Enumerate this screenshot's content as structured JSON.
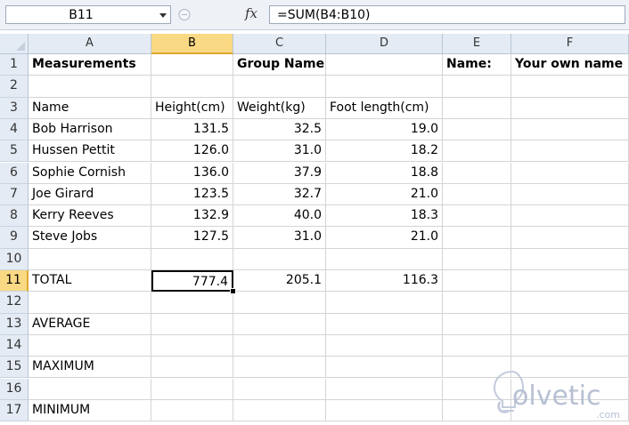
{
  "formula_bar": {
    "cell_ref": "B11",
    "fx_label": "fx",
    "formula": "=SUM(B4:B10)"
  },
  "columns": [
    "A",
    "B",
    "C",
    "D",
    "E",
    "F"
  ],
  "rows": [
    "1",
    "2",
    "3",
    "4",
    "5",
    "6",
    "7",
    "8",
    "9",
    "10",
    "11",
    "12",
    "13",
    "14",
    "15",
    "16",
    "17"
  ],
  "cells": {
    "r1": [
      "Measurements",
      "",
      "Group Name",
      "",
      "Name:",
      "Your own name"
    ],
    "r2": [
      "",
      "",
      "",
      "",
      "",
      ""
    ],
    "r3": [
      "Name",
      "Height(cm)",
      "Weight(kg)",
      "Foot length(cm)",
      "",
      ""
    ],
    "r4": [
      "Bob Harrison",
      "131.5",
      "32.5",
      "19.0",
      "",
      ""
    ],
    "r5": [
      "Hussen Pettit",
      "126.0",
      "31.0",
      "18.2",
      "",
      ""
    ],
    "r6": [
      "Sophie Cornish",
      "136.0",
      "37.9",
      "18.8",
      "",
      ""
    ],
    "r7": [
      "Joe Girard",
      "123.5",
      "32.7",
      "21.0",
      "",
      ""
    ],
    "r8": [
      "Kerry Reeves",
      "132.9",
      "40.0",
      "18.3",
      "",
      ""
    ],
    "r9": [
      "Steve Jobs",
      "127.5",
      "31.0",
      "21.0",
      "",
      ""
    ],
    "r10": [
      "",
      "",
      "",
      "",
      "",
      ""
    ],
    "r11": [
      "TOTAL",
      "777.4",
      "205.1",
      "116.3",
      "",
      ""
    ],
    "r12": [
      "",
      "",
      "",
      "",
      "",
      ""
    ],
    "r13": [
      "AVERAGE",
      "",
      "",
      "",
      "",
      ""
    ],
    "r14": [
      "",
      "",
      "",
      "",
      "",
      ""
    ],
    "r15": [
      "MAXIMUM",
      "",
      "",
      "",
      "",
      ""
    ],
    "r16": [
      "",
      "",
      "",
      "",
      "",
      ""
    ],
    "r17": [
      "MINIMUM",
      "",
      "",
      "",
      "",
      ""
    ]
  },
  "selection": {
    "col": "B",
    "row": "11"
  },
  "watermark": {
    "brand": "olvetic",
    "suffix": ".com"
  },
  "colors": {
    "header_bg": "#e4ebf4",
    "active_header_bg": "#f9d983",
    "grid_line": "#d4d4d4",
    "watermark": "#b7c0d3"
  }
}
